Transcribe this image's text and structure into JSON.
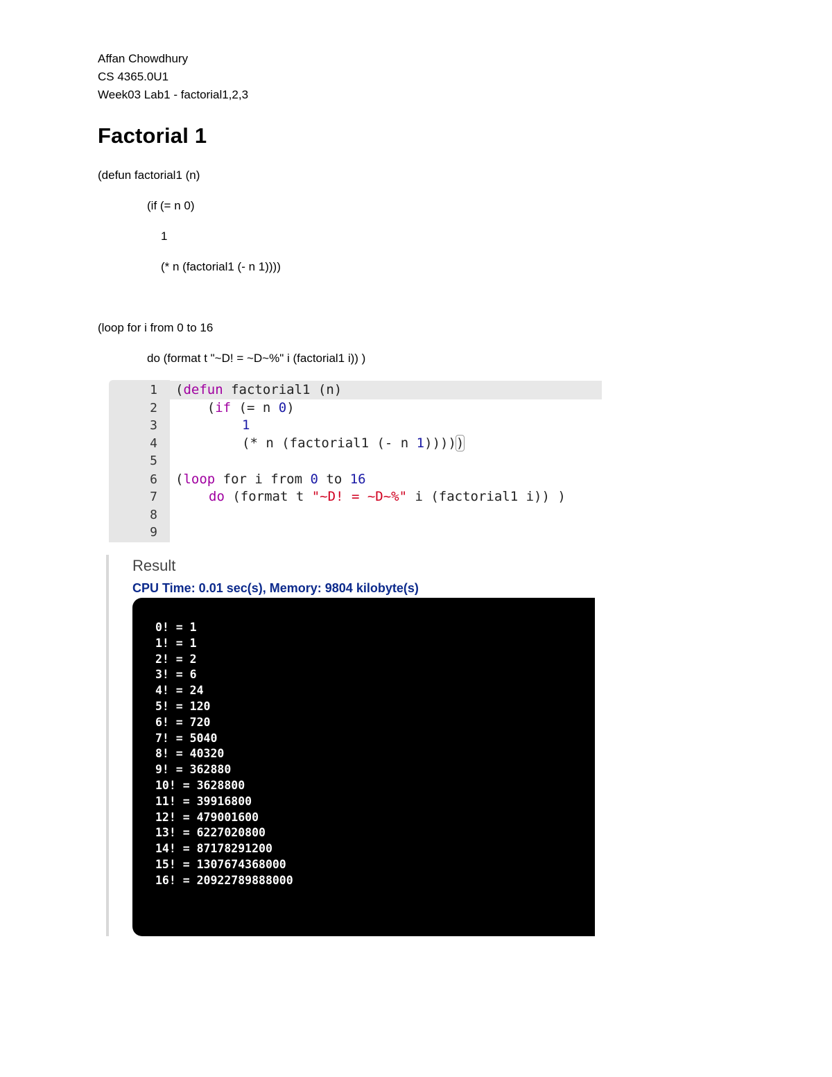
{
  "header": {
    "author": "Affan Chowdhury",
    "course": "CS 4365.0U1",
    "assignment": "Week03 Lab1 - factorial1,2,3"
  },
  "section_title": "Factorial 1",
  "source_text": {
    "line1": "(defun factorial1 (n)",
    "line2": "(if (= n 0)",
    "line3": "1",
    "line4": "(* n (factorial1 (- n 1))))",
    "line5": "(loop for i from 0 to 16",
    "line6": "do (format t \"~D! = ~D~%\" i (factorial1 i)) )"
  },
  "editor": {
    "line_numbers": [
      "1",
      "2",
      "3",
      "4",
      "5",
      "6",
      "7",
      "8",
      "9"
    ],
    "code": {
      "l1_open": "(",
      "l1_defun": "defun",
      "l1_rest": " factorial1 (n)",
      "l2_open": "    (",
      "l2_if": "if",
      "l2_mid": " (= n ",
      "l2_zero": "0",
      "l2_close": ")",
      "l3_one": "1",
      "l4_a": "(* n (factorial1 (- n ",
      "l4_one": "1",
      "l4_b": "))))",
      "l4_c": ")",
      "l6_open": "(",
      "l6_loop": "loop",
      "l6_for": " for i from ",
      "l6_zero": "0",
      "l6_to": " to ",
      "l6_sixteen": "16",
      "l7_do": "do",
      "l7_format": " (format t ",
      "l7_str1": "\"~D!",
      "l7_eq": " = ",
      "l7_str2": "~D~%\"",
      "l7_rest": " i (factorial1 i)) )"
    }
  },
  "result": {
    "title": "Result",
    "stats": "CPU Time: 0.01 sec(s), Memory: 9804 kilobyte(s)",
    "output_lines": [
      "0! = 1",
      "1! = 1",
      "2! = 2",
      "3! = 6",
      "4! = 24",
      "5! = 120",
      "6! = 720",
      "7! = 5040",
      "8! = 40320",
      "9! = 362880",
      "10! = 3628800",
      "11! = 39916800",
      "12! = 479001600",
      "13! = 6227020800",
      "14! = 87178291200",
      "15! = 1307674368000",
      "16! = 20922789888000"
    ]
  }
}
